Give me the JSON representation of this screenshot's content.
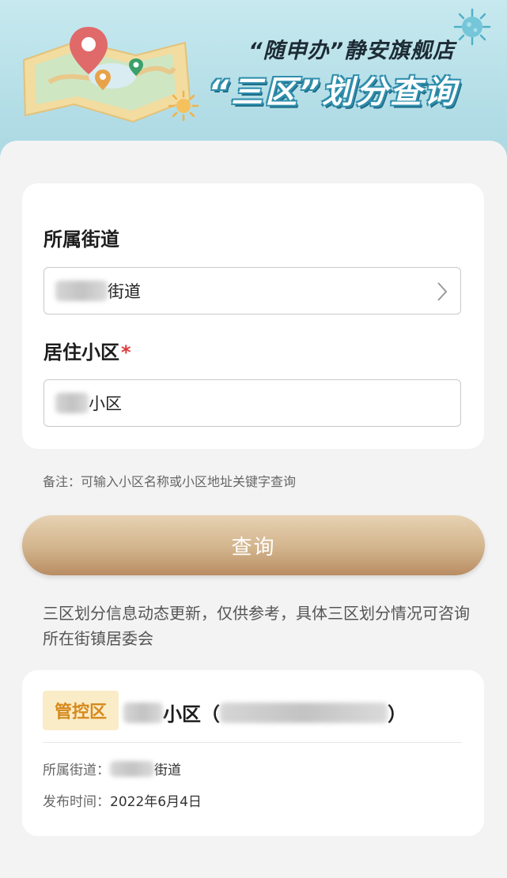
{
  "banner": {
    "line1": "“随申办”静安旗舰店",
    "line2": "“三区”划分查询"
  },
  "form": {
    "street_label": "所属街道",
    "street_value_suffix": "街道",
    "community_label": "居住小区",
    "required_mark": "*",
    "community_value_suffix": "小区"
  },
  "note": "备注：可输入小区名称或小区地址关键字查询",
  "query_button_label": "查询",
  "disclaimer": "三区划分信息动态更新，仅供参考，具体三区划分情况可咨询所在街镇居委会",
  "result": {
    "badge": "管控区",
    "title_suffix": "小区（",
    "title_close": "）",
    "street_key": "所属街道：",
    "street_value_suffix": "街道",
    "time_key": "发布时间：",
    "time_value": "2022年6月4日"
  },
  "colors": {
    "badge_bg": "#fbecc8",
    "badge_text": "#d68a1c",
    "button_gold": "#d2b48c",
    "required": "#e03a3a"
  },
  "icons": [
    "map-pin-icon",
    "chevron-right-icon",
    "virus-icon",
    "sun-icon"
  ]
}
